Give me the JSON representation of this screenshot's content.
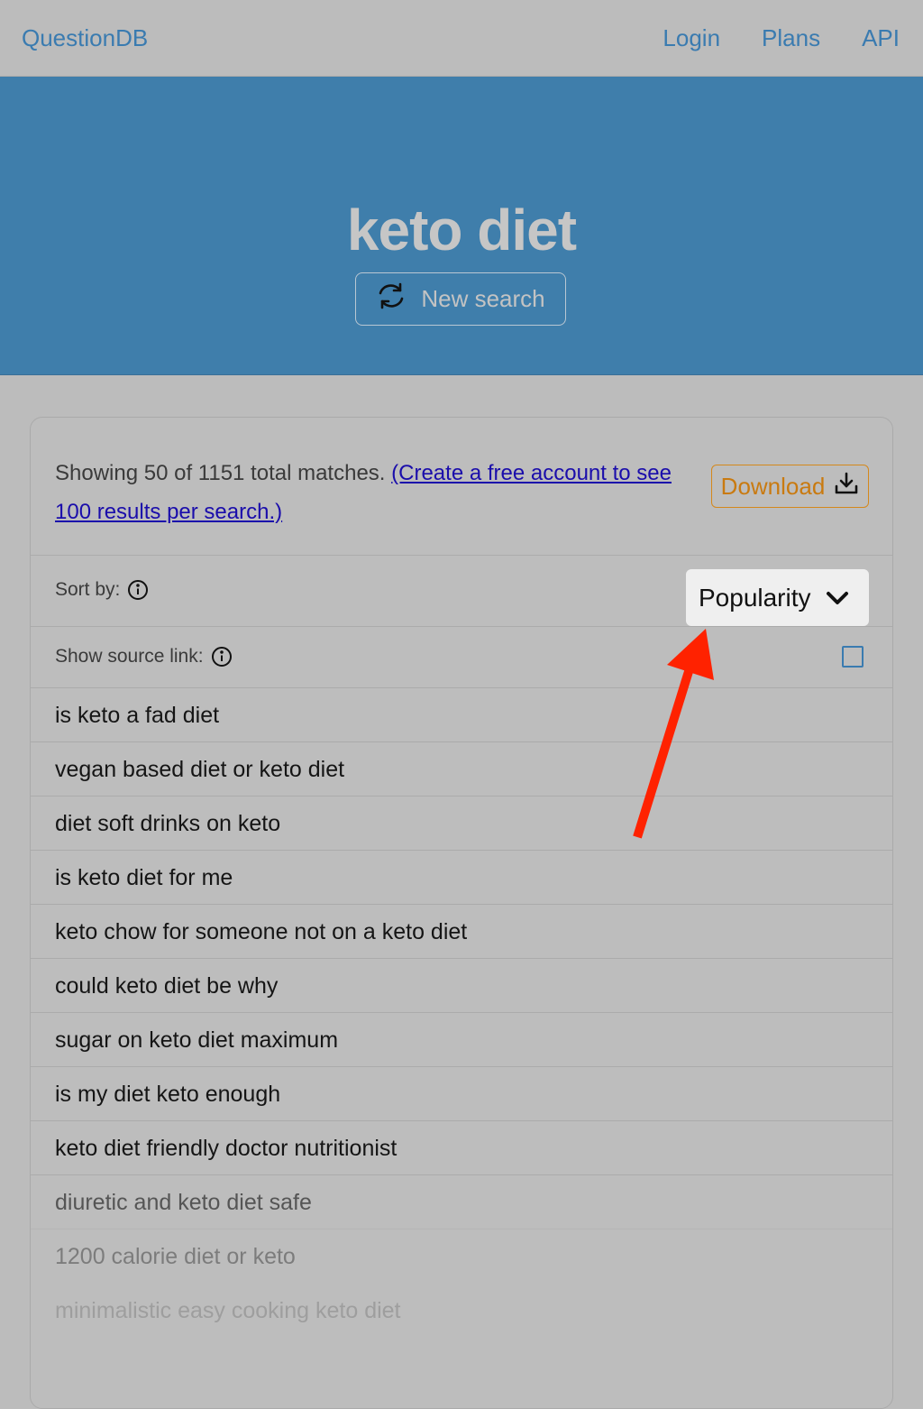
{
  "nav": {
    "brand": "QuestionDB",
    "links": [
      "Login",
      "Plans",
      "API"
    ]
  },
  "hero": {
    "title": "keto diet",
    "new_search_label": "New search",
    "new_search_icon": "refresh-icon"
  },
  "summary": {
    "text": "Showing 50 of 1151 total matches.",
    "link_text": "(Create a free account to see 100 results per search.)",
    "download_label": "Download",
    "download_icon": "download-icon"
  },
  "options": {
    "sort_label": "Sort by:",
    "sort_value": "Popularity",
    "source_label": "Show source link:",
    "source_checked": false
  },
  "results": [
    "is keto a fad diet",
    "vegan based diet or keto diet",
    "diet soft drinks on keto",
    "is keto diet for me",
    "keto chow for someone not on a keto diet",
    "could keto diet be why",
    "sugar on keto diet maximum",
    "is my diet keto enough",
    "keto diet friendly doctor nutritionist",
    "diuretic and keto diet safe",
    "1200 calorie diet or keto",
    "minimalistic easy cooking keto diet"
  ],
  "colors": {
    "accent": "#3a7bb0",
    "hero_bg": "#3f7eab",
    "download": "#c97a10",
    "annotation_arrow": "#ff2200"
  }
}
